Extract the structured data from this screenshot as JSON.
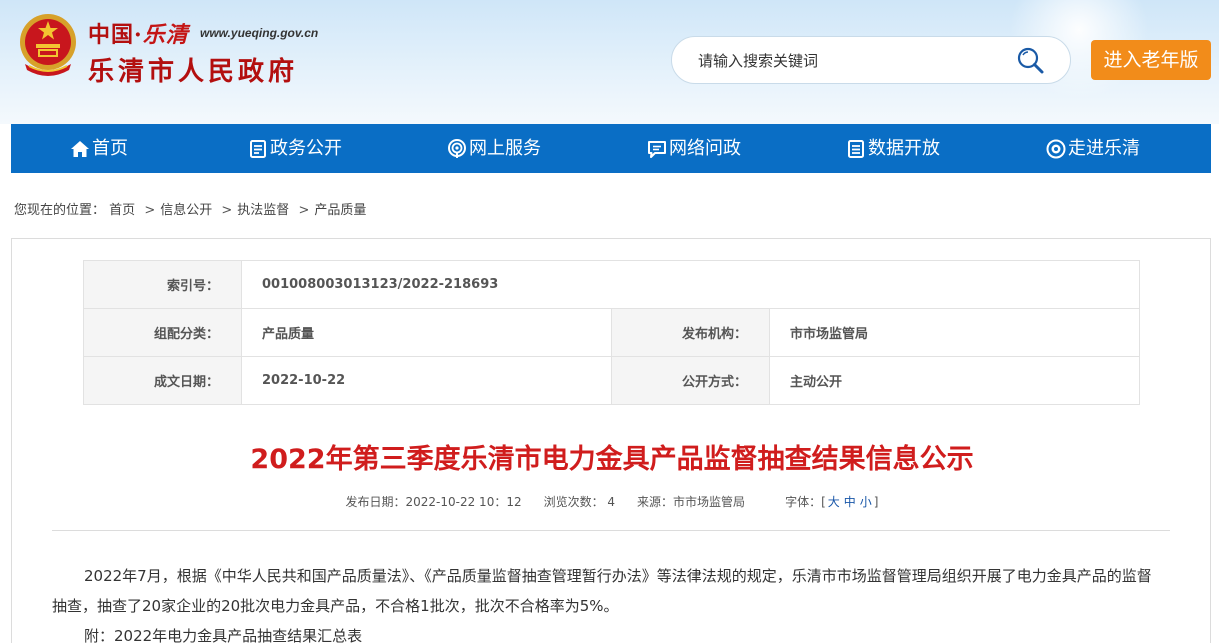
{
  "header": {
    "logo_cn_left": "中国",
    "logo_cn_dot": "·",
    "logo_cn_script": "乐清",
    "logo_url": "www.yueqing.gov.cn",
    "site_title": "乐清市人民政府",
    "search_placeholder": "请输入搜索关键词",
    "elder_button": "进入老年版",
    "emblem_icon": "national-emblem-icon",
    "search_icon": "magnifier-icon"
  },
  "nav": {
    "items": [
      {
        "label": "首页",
        "icon": "home-icon"
      },
      {
        "label": "政务公开",
        "icon": "document-icon"
      },
      {
        "label": "网上服务",
        "icon": "broadcast-icon"
      },
      {
        "label": "网络问政",
        "icon": "chat-icon"
      },
      {
        "label": "数据开放",
        "icon": "data-icon"
      },
      {
        "label": "走进乐清",
        "icon": "eye-icon"
      }
    ],
    "bg_color": "#0a6ec5"
  },
  "breadcrumb": {
    "prefix": "您现在的位置：",
    "items": [
      "首页",
      "信息公开",
      "执法监督",
      "产品质量"
    ],
    "separator": ">"
  },
  "meta": {
    "index_label": "索引号：",
    "index_value": "001008003013123/2022-218693",
    "category_label": "组配分类：",
    "category_value": "产品质量",
    "publisher_label": "发布机构：",
    "publisher_value": "市市场监管局",
    "date_label": "成文日期：",
    "date_value": "2022-10-22",
    "disclosure_label": "公开方式：",
    "disclosure_value": "主动公开"
  },
  "article": {
    "title": "2022年第三季度乐清市电力金具产品监督抽查结果信息公示",
    "publish_date": "发布日期：2022-10-22 10：12",
    "views": "浏览次数： 4",
    "source": "来源：市市场监管局",
    "font_size_label": "字体：[",
    "font_large": "大",
    "font_medium": "中",
    "font_small": "小",
    "font_size_close": "]",
    "paragraph1": "2022年7月，根据《中华人民共和国产品质量法》、《产品质量监督抽查管理暂行办法》等法律法规的规定，乐清市市场监督管理局组织开展了电力金具产品的监督抽查，抽查了20家企业的20批次电力金具产品，不合格1批次，批次不合格率为5%。",
    "attachment": "附：2022年电力金具产品抽查结果汇总表",
    "title_color": "#d01d1d"
  }
}
